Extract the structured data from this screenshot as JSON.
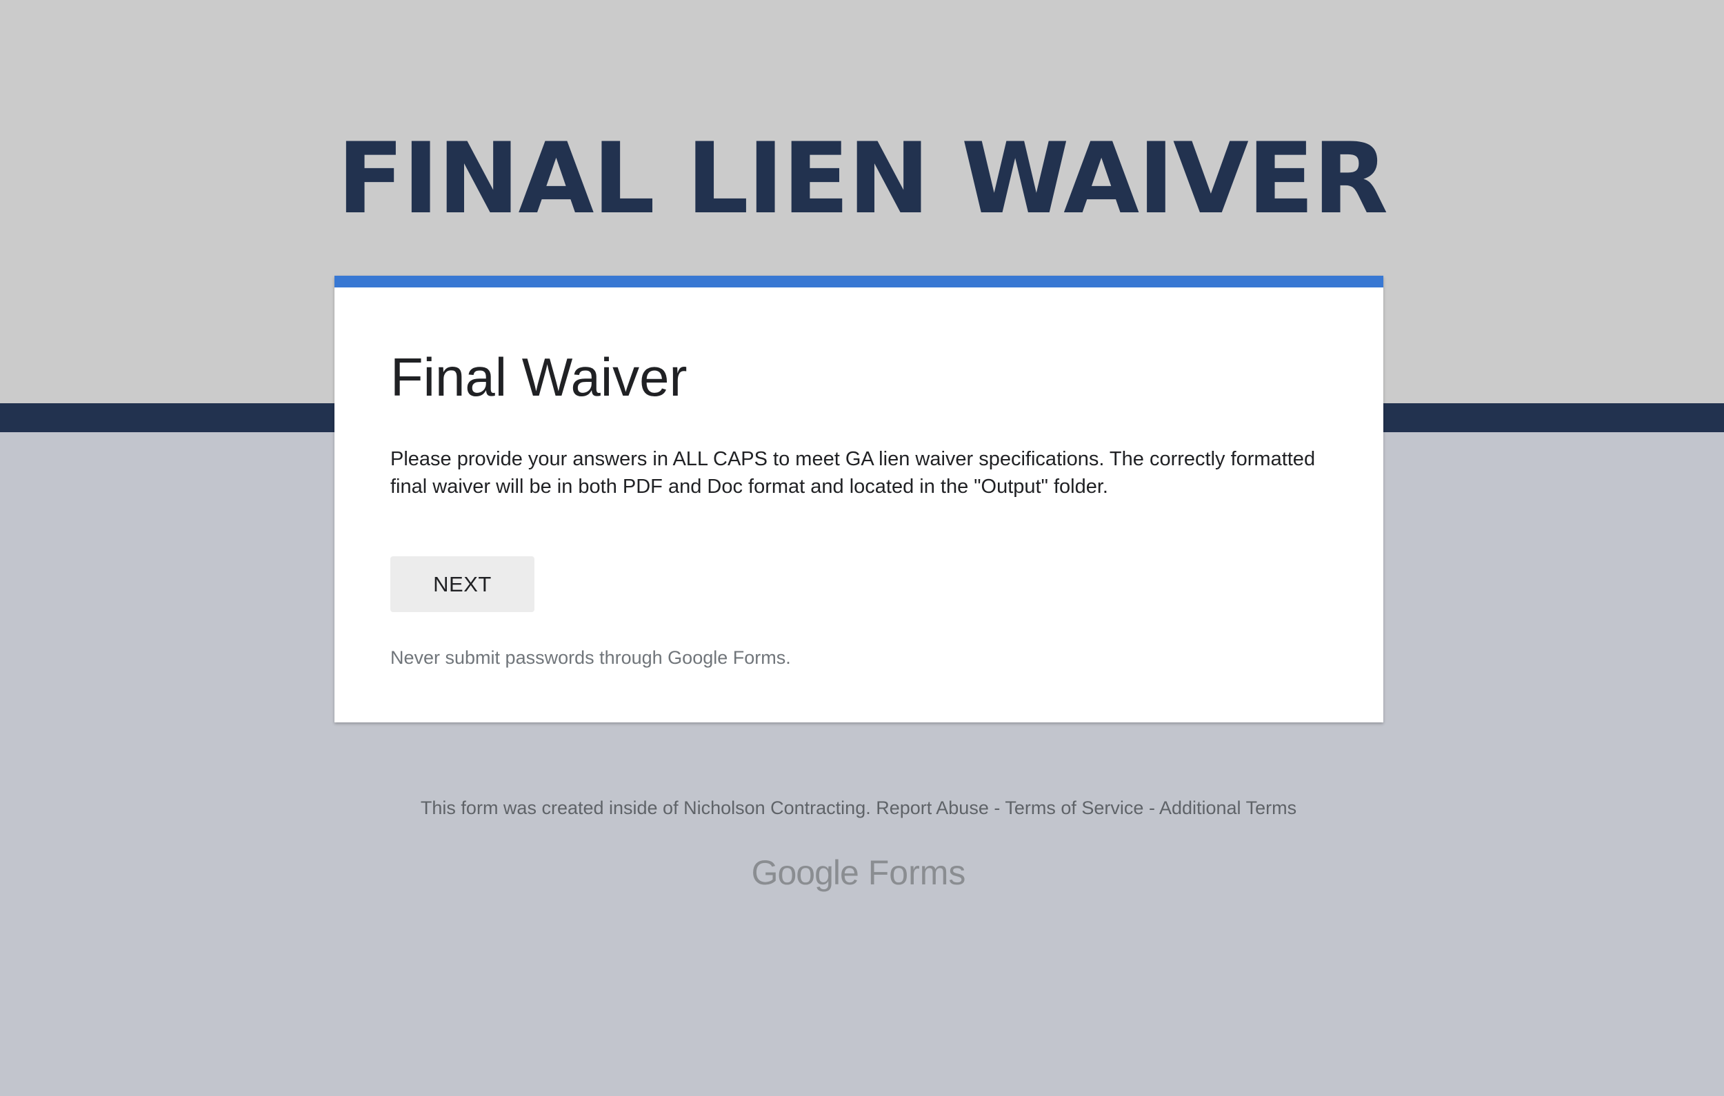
{
  "banner": {
    "title": "FINAL LIEN WAIVER"
  },
  "form": {
    "title": "Final Waiver",
    "description": "Please provide your answers in ALL CAPS to meet GA lien waiver specifications. The correctly formatted final waiver will be in both PDF and Doc format and located in the \"Output\" folder.",
    "next_label": "NEXT",
    "warning": "Never submit passwords through Google Forms."
  },
  "footer": {
    "created_text": "This form was created inside of Nicholson Contracting.",
    "report_abuse": "Report Abuse",
    "separator": "-",
    "terms_of_service": "Terms of Service",
    "additional_terms": "Additional Terms",
    "logo_google": "Google",
    "logo_forms": "Forms"
  },
  "colors": {
    "banner_bg": "#cbcbcb",
    "stripe": "#22324f",
    "page_bg": "#c2c5cd",
    "accent": "#3878d3"
  }
}
